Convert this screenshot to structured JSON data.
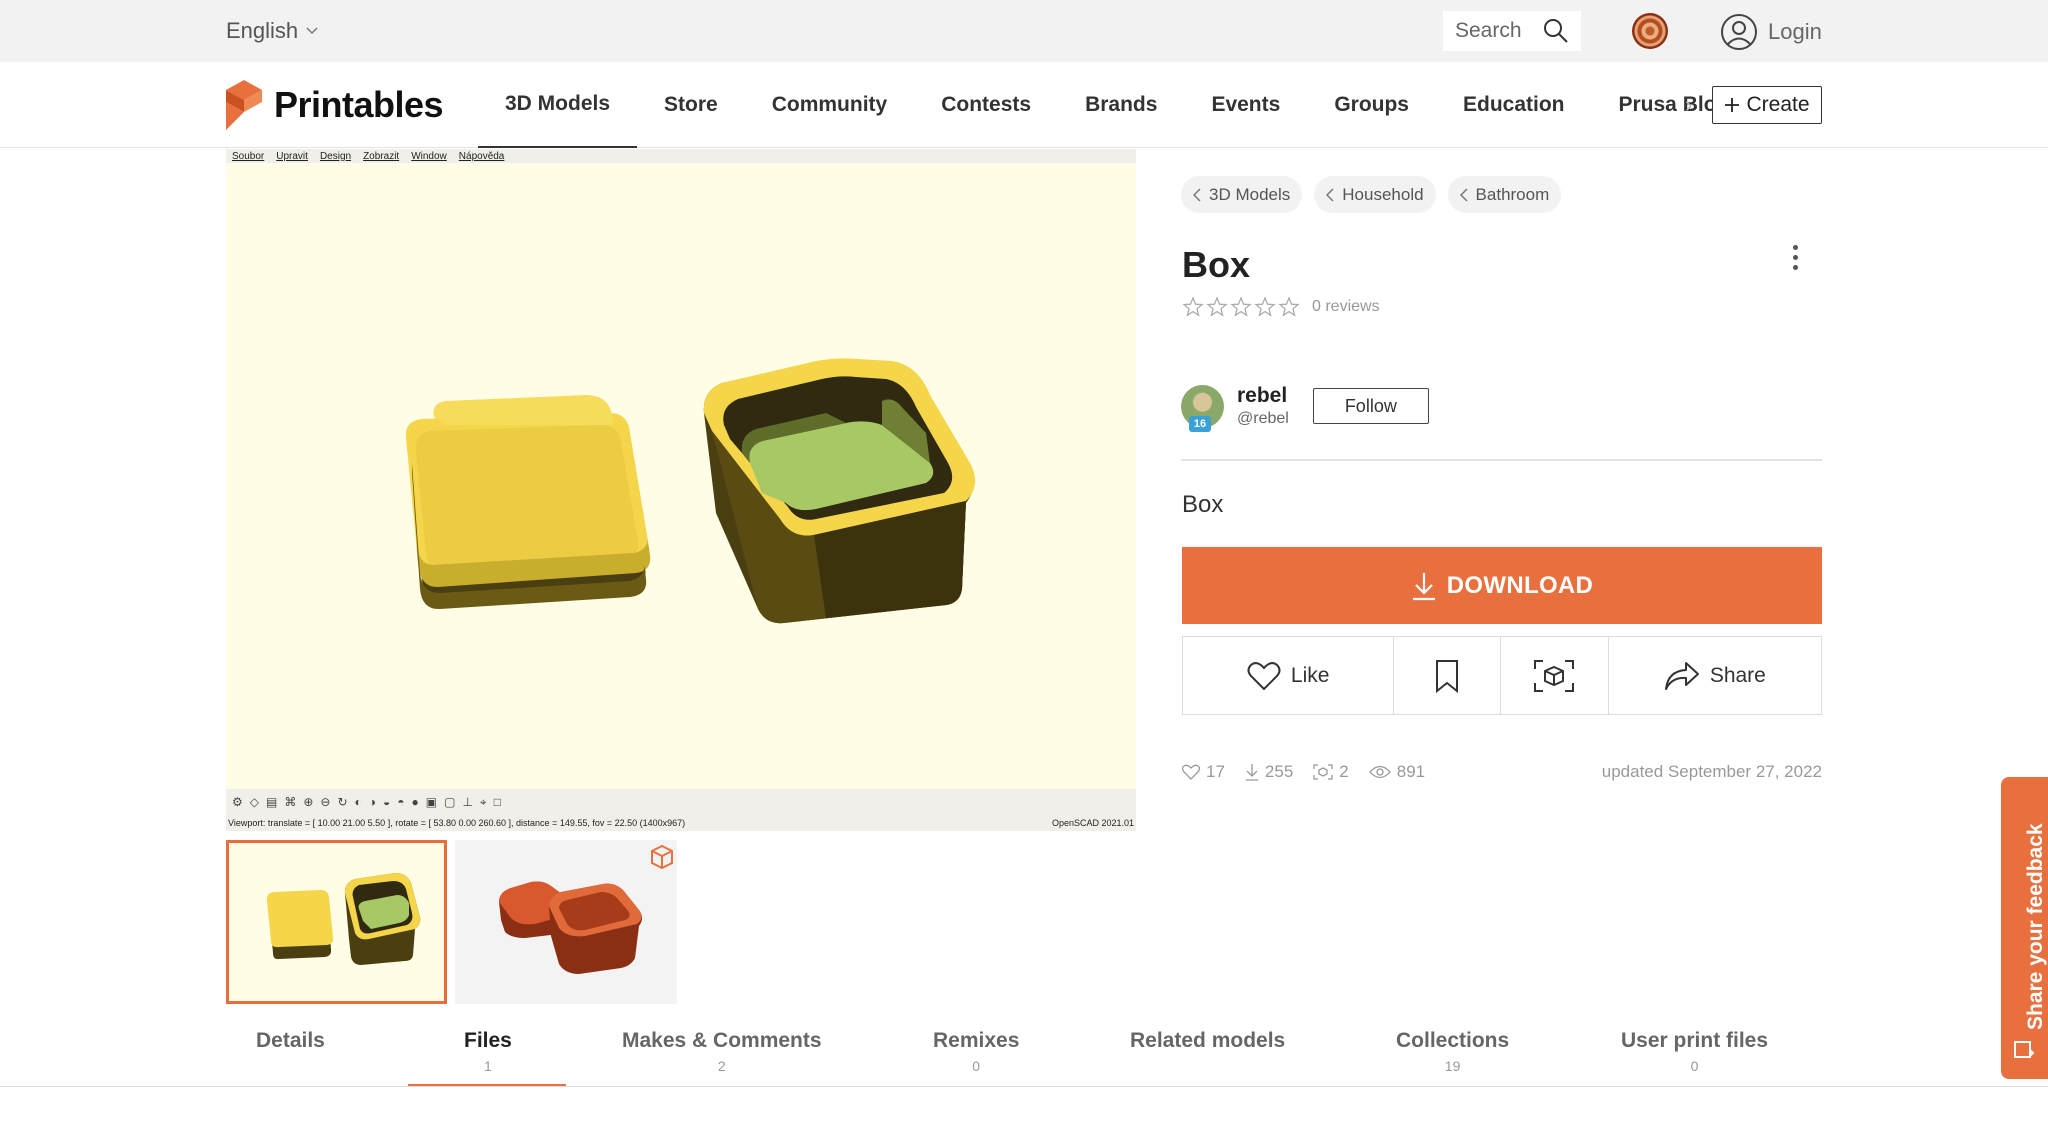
{
  "topbar": {
    "language": "English",
    "search_placeholder": "Search",
    "login_label": "Login"
  },
  "nav": {
    "logo_text": "Printables",
    "links": [
      "3D Models",
      "Store",
      "Community",
      "Contests",
      "Brands",
      "Events",
      "Groups",
      "Education",
      "Prusa Blog"
    ],
    "active": "3D Models",
    "create_label": "Create"
  },
  "viewer": {
    "menu": [
      "Soubor",
      "Upravit",
      "Design",
      "Zobrazit",
      "Window",
      "Nápověda"
    ],
    "status_left": "Viewport: translate = [ 10.00 21.00 5.50 ], rotate = [ 53.80 0.00 260.60 ], distance = 149.55, fov = 22.50 (1400x967)",
    "status_right": "OpenSCAD 2021.01"
  },
  "breadcrumbs": [
    "3D Models",
    "Household",
    "Bathroom"
  ],
  "model": {
    "title": "Box",
    "rating_stars": 0,
    "reviews": "0 reviews",
    "summary": "Box"
  },
  "author": {
    "name": "rebel",
    "handle": "@rebel",
    "badge": "16",
    "follow_label": "Follow"
  },
  "actions": {
    "download_label": "DOWNLOAD",
    "like_label": "Like",
    "share_label": "Share"
  },
  "stats": {
    "likes": "17",
    "downloads": "255",
    "makes": "2",
    "views": "891",
    "updated": "updated September 27, 2022"
  },
  "tabs": [
    {
      "label": "Details",
      "count": ""
    },
    {
      "label": "Files",
      "count": "1"
    },
    {
      "label": "Makes & Comments",
      "count": "2"
    },
    {
      "label": "Remixes",
      "count": "0"
    },
    {
      "label": "Related models",
      "count": ""
    },
    {
      "label": "Collections",
      "count": "19"
    },
    {
      "label": "User print files",
      "count": "0"
    }
  ],
  "active_tab": "Files",
  "feedback_label": "Share your feedback",
  "colors": {
    "accent": "#e8703f",
    "model_yellow": "#f5d54a",
    "model_inner_green": "#a8c866",
    "model_orange": "#d9582e",
    "viewer_bg": "#fffde6"
  }
}
